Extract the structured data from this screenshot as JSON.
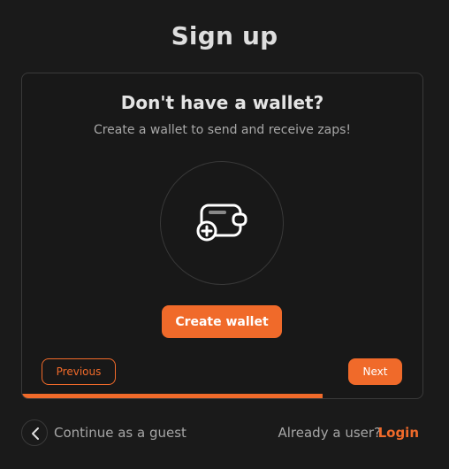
{
  "page": {
    "title": "Sign up"
  },
  "card": {
    "heading": "Don't have a wallet?",
    "subtitle": "Create a wallet to send and receive zaps!",
    "icon": "wallet-add-icon",
    "create_label": "Create wallet",
    "previous_label": "Previous",
    "next_label": "Next",
    "progress_fraction": 0.75
  },
  "footer": {
    "guest_label": "Continue as a guest",
    "already_label": "Already a user?",
    "login_label": "Login",
    "back_icon": "chevron-left-icon"
  },
  "colors": {
    "accent": "#f06a2a",
    "background": "#1a1a1a",
    "border": "#3a3a3a"
  }
}
